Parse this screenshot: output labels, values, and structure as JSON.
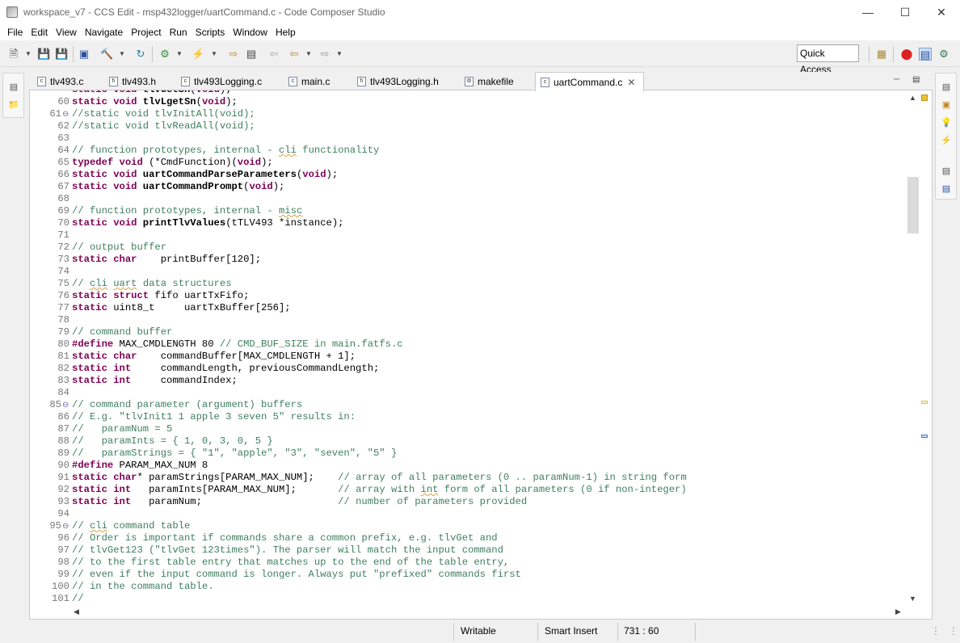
{
  "window": {
    "title": "workspace_v7 - CCS Edit - msp432logger/uartCommand.c - Code Composer Studio",
    "minimize": "—",
    "maximize": "☐",
    "close": "✕"
  },
  "menu": [
    "File",
    "Edit",
    "View",
    "Navigate",
    "Project",
    "Run",
    "Scripts",
    "Window",
    "Help"
  ],
  "toolbar": {
    "quick_access": "Quick Access"
  },
  "tabs": [
    {
      "label": "tlv493.c",
      "icon": "c-file-icon",
      "active": false
    },
    {
      "label": "tlv493.h",
      "icon": "h-file-icon",
      "active": false
    },
    {
      "label": "tlv493Logging.c",
      "icon": "c-file-icon",
      "active": false
    },
    {
      "label": "main.c",
      "icon": "c-file-icon",
      "active": false
    },
    {
      "label": "tlv493Logging.h",
      "icon": "h-file-icon",
      "active": false
    },
    {
      "label": "makefile",
      "icon": "makefile-icon",
      "active": false
    },
    {
      "label": "uartCommand.c",
      "icon": "c-file-icon",
      "active": true
    }
  ],
  "editor": {
    "line_numbers": [
      "",
      "60",
      "61",
      "62",
      "63",
      "64",
      "65",
      "66",
      "67",
      "68",
      "69",
      "70",
      "71",
      "72",
      "73",
      "74",
      "75",
      "76",
      "77",
      "78",
      "79",
      "80",
      "81",
      "82",
      "83",
      "84",
      "85",
      "86",
      "87",
      "88",
      "89",
      "90",
      "91",
      "92",
      "93",
      "94",
      "95",
      "96",
      "97",
      "98",
      "99",
      "100",
      "101"
    ],
    "folded_lines": [
      "61",
      "85",
      "95"
    ]
  },
  "status": {
    "writable": "Writable",
    "insert_mode": "Smart Insert",
    "cursor": "731 : 60"
  },
  "colors": {
    "keyword": "#7f0055",
    "comment": "#3f7f5f",
    "string": "#2a00ff",
    "line_number": "#787878"
  }
}
